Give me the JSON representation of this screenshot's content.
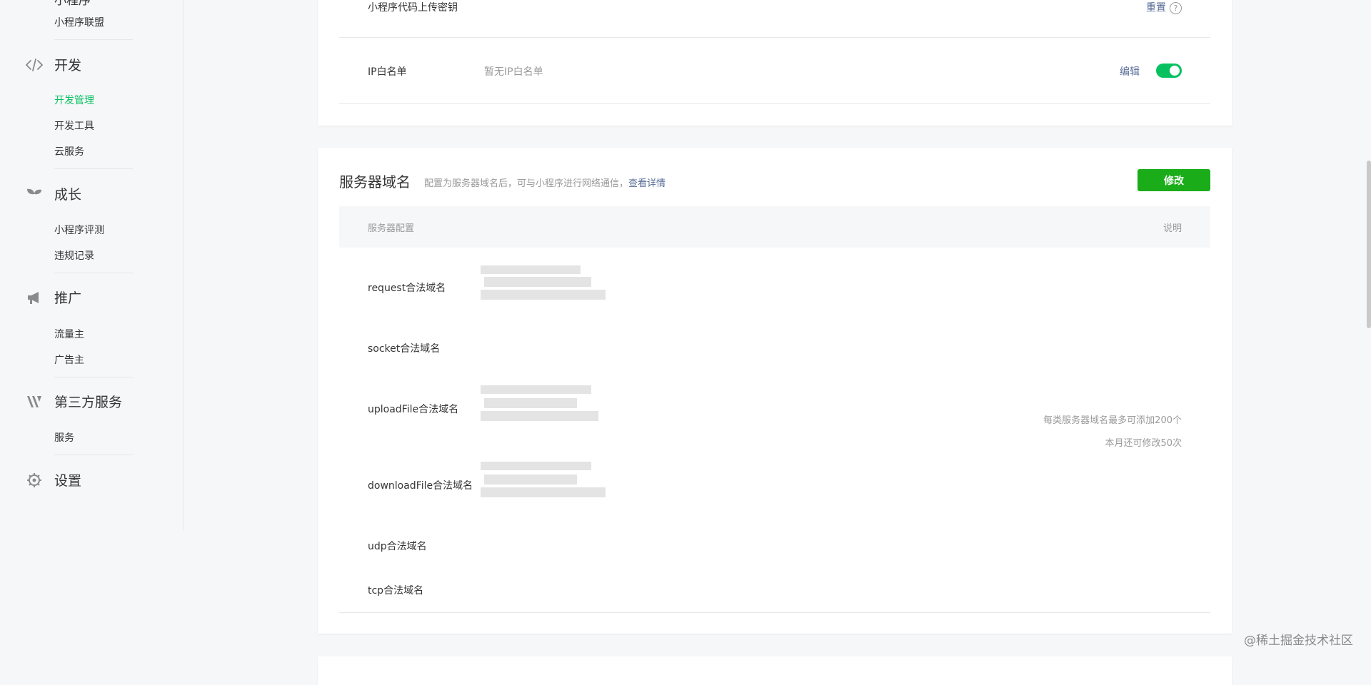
{
  "sidebar": {
    "top_partial": "小程序",
    "top_sub": "小程序联盟",
    "sections": [
      {
        "title": "开发",
        "icon": "code-icon",
        "items": [
          "开发管理",
          "开发工具",
          "云服务"
        ]
      },
      {
        "title": "成长",
        "icon": "sprout-icon",
        "items": [
          "小程序评测",
          "违规记录"
        ]
      },
      {
        "title": "推广",
        "icon": "megaphone-icon",
        "items": [
          "流量主",
          "广告主"
        ]
      },
      {
        "title": "第三方服务",
        "icon": "third-party-icon",
        "items": [
          "服务"
        ]
      },
      {
        "title": "设置",
        "icon": "gear-icon",
        "items": []
      }
    ],
    "active_item": "开发管理"
  },
  "card_top": {
    "secret_label": "小程序代码上传密钥",
    "secret_action": "重置",
    "help_glyph": "?",
    "ip_label": "IP白名单",
    "ip_value": "暂无IP白名单",
    "ip_action": "编辑",
    "ip_toggle_on": true
  },
  "server_domain": {
    "title": "服务器域名",
    "desc": "配置为服务器域名后，可与小程序进行网络通信，",
    "desc_link": "查看详情",
    "modify_button": "修改",
    "table": {
      "col_config": "服务器配置",
      "col_desc": "说明",
      "rows": [
        "request合法域名",
        "socket合法域名",
        "uploadFile合法域名",
        "downloadFile合法域名",
        "udp合法域名",
        "tcp合法域名"
      ]
    },
    "note_line1": "每类服务器域名最多可添加200个",
    "note_line2": "本月还可修改50次"
  },
  "watermark": "@稀土掘金技术社区",
  "colors": {
    "accent_green": "#07c160",
    "button_green": "#1aad19",
    "link_blue": "#576b95"
  }
}
